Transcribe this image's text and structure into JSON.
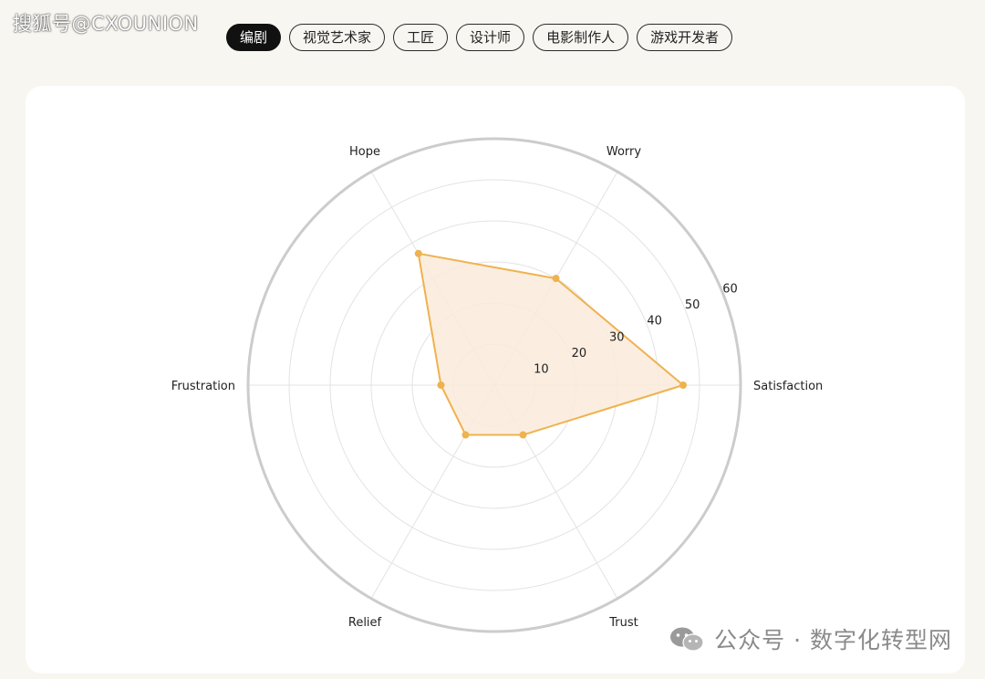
{
  "watermark_top": "搜狐号@CXOUNION",
  "tabs": [
    {
      "label": "编剧",
      "active": true
    },
    {
      "label": "视觉艺术家",
      "active": false
    },
    {
      "label": "工匠",
      "active": false
    },
    {
      "label": "设计师",
      "active": false
    },
    {
      "label": "电影制作人",
      "active": false
    },
    {
      "label": "游戏开发者",
      "active": false
    }
  ],
  "watermark_bottom": "公众号 · 数字化转型网",
  "colors": {
    "series_stroke": "#efb24e",
    "series_fill": "#faebda",
    "grid": "#e3e3e3",
    "outer_ring": "#cccccc"
  },
  "chart_data": {
    "type": "radar",
    "axes": [
      "Satisfaction",
      "Worry",
      "Hope",
      "Frustration",
      "Relief",
      "Trust"
    ],
    "series": [
      {
        "values": [
          46,
          30,
          37,
          13,
          14,
          14
        ]
      }
    ],
    "rlim": [
      0,
      60
    ],
    "r_ticks": [
      10,
      20,
      30,
      40,
      50,
      60
    ],
    "grid": true,
    "legend": "none"
  }
}
